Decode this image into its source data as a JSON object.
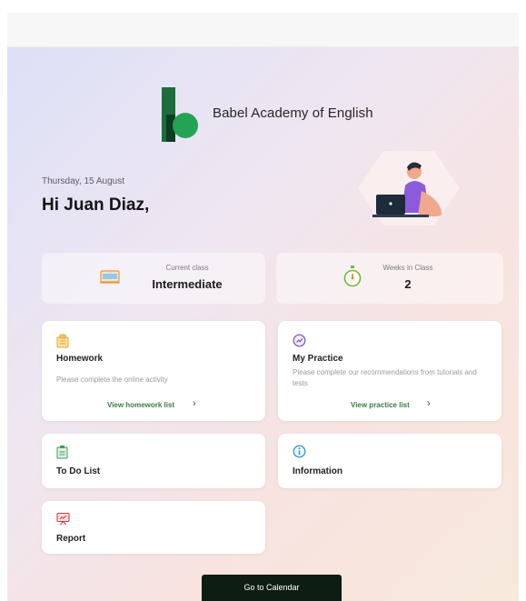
{
  "header": {
    "brand_name": "Babel Academy of English"
  },
  "greeting": {
    "date": "Thursday, 15 August",
    "hello": "Hi Juan Diaz,"
  },
  "stats": [
    {
      "label": "Current class",
      "value": "Intermediate",
      "icon": "laptop-icon"
    },
    {
      "label": "Weeks in Class",
      "value": "2",
      "icon": "stopwatch-icon"
    }
  ],
  "cards": {
    "homework": {
      "title": "Homework",
      "description": "Please complete the online activity",
      "link": "View homework list",
      "chevron": "›",
      "icon": "homework-icon"
    },
    "practice": {
      "title": "My Practice",
      "description": "Please complete our recommendations from tutorials and tests",
      "link": "View practice list",
      "chevron": "›",
      "icon": "practice-icon"
    },
    "todo": {
      "title": "To Do List",
      "icon": "clipboard-icon"
    },
    "information": {
      "title": "Information",
      "icon": "info-icon"
    },
    "report": {
      "title": "Report",
      "icon": "report-icon"
    }
  },
  "footer": {
    "calendar_button": "Go to Calendar"
  },
  "colors": {
    "accent_green": "#1e6b3e",
    "link_green": "#3d7a48",
    "button_dark": "#0e1d13"
  }
}
